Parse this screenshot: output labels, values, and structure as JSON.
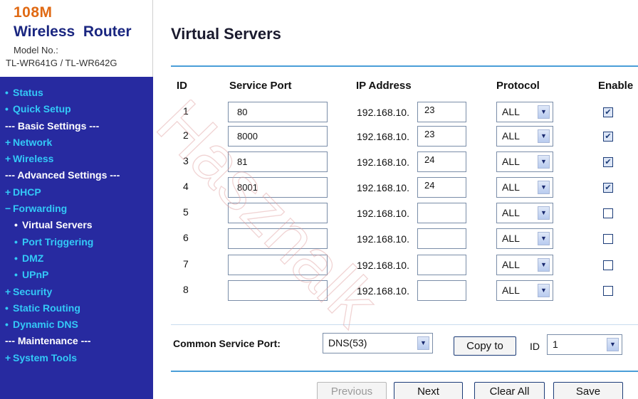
{
  "header": {
    "brand_model": "108M",
    "brand_name": "Wireless  Router",
    "model_label": "Model No.:",
    "model_value": "TL-WR641G / TL-WR642G"
  },
  "sidebar": {
    "items": [
      {
        "label": "Status",
        "bullet": "•"
      },
      {
        "label": "Quick Setup",
        "bullet": "•"
      },
      {
        "label": "--- Basic Settings ---"
      },
      {
        "label": "Network",
        "bullet": "+"
      },
      {
        "label": "Wireless",
        "bullet": "+"
      },
      {
        "label": "--- Advanced Settings ---"
      },
      {
        "label": "DHCP",
        "bullet": "+"
      },
      {
        "label": "Forwarding",
        "bullet": "−"
      },
      {
        "label": "Virtual Servers",
        "bullet": "•"
      },
      {
        "label": "Port Triggering",
        "bullet": "•"
      },
      {
        "label": "DMZ",
        "bullet": "•"
      },
      {
        "label": "UPnP",
        "bullet": "•"
      },
      {
        "label": "Security",
        "bullet": "+"
      },
      {
        "label": "Static Routing",
        "bullet": "•"
      },
      {
        "label": "Dynamic DNS",
        "bullet": "•"
      },
      {
        "label": "--- Maintenance ---"
      },
      {
        "label": "System Tools",
        "bullet": "+"
      }
    ]
  },
  "main": {
    "title": "Virtual Servers",
    "columns": {
      "id": "ID",
      "service_port": "Service Port",
      "ip_address": "IP Address",
      "protocol": "Protocol",
      "enable": "Enable"
    },
    "ip_prefix": "192.168.10.",
    "rows": [
      {
        "id": "1",
        "port": "80",
        "ip": "23",
        "protocol": "ALL",
        "enabled": true
      },
      {
        "id": "2",
        "port": "8000",
        "ip": "23",
        "protocol": "ALL",
        "enabled": true
      },
      {
        "id": "3",
        "port": "81",
        "ip": "24",
        "protocol": "ALL",
        "enabled": true
      },
      {
        "id": "4",
        "port": "8001",
        "ip": "24",
        "protocol": "ALL",
        "enabled": true
      },
      {
        "id": "5",
        "port": "",
        "ip": "",
        "protocol": "ALL",
        "enabled": false
      },
      {
        "id": "6",
        "port": "",
        "ip": "",
        "protocol": "ALL",
        "enabled": false
      },
      {
        "id": "7",
        "port": "",
        "ip": "",
        "protocol": "ALL",
        "enabled": false
      },
      {
        "id": "8",
        "port": "",
        "ip": "",
        "protocol": "ALL",
        "enabled": false
      }
    ],
    "common_service_port_label": "Common Service Port:",
    "common_service_port_value": "DNS(53)",
    "copy_to_label": "Copy to",
    "id_label": "ID",
    "id_value": "1",
    "buttons": {
      "previous": "Previous",
      "next": "Next",
      "clear_all": "Clear All",
      "save": "Save"
    }
  },
  "watermark_text": "Hasznalk",
  "colors": {
    "sidebar_bg": "#272aa0",
    "nav_link": "#33c9f7",
    "rule": "#4a9ed8",
    "brand_orange": "#e06a14",
    "brand_blue": "#1a2680"
  }
}
